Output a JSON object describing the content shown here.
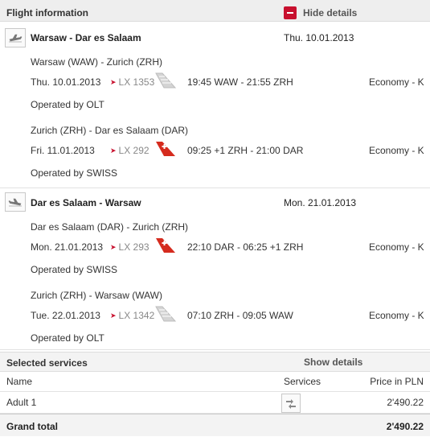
{
  "flight_information": {
    "title": "Flight information",
    "toggle_label": "Hide details",
    "journeys": [
      {
        "title": "Warsaw - Dar es Salaam",
        "date": "Thu. 10.01.2013",
        "segments": [
          {
            "route": "Warsaw (WAW) - Zurich (ZRH)",
            "date": "Thu. 10.01.2013",
            "flight": "LX 1353",
            "times": "19:45 WAW - 21:55 ZRH",
            "class": "Economy - K",
            "operated": "Operated by OLT",
            "tail": "grey"
          },
          {
            "route": "Zurich (ZRH) - Dar es Salaam (DAR)",
            "date": "Fri. 11.01.2013",
            "flight": "LX 292",
            "times": "09:25 +1 ZRH - 21:00 DAR",
            "class": "Economy - K",
            "operated": "Operated by SWISS",
            "tail": "swiss"
          }
        ]
      },
      {
        "title": "Dar es Salaam - Warsaw",
        "date": "Mon. 21.01.2013",
        "segments": [
          {
            "route": "Dar es Salaam (DAR) - Zurich (ZRH)",
            "date": "Mon. 21.01.2013",
            "flight": "LX 293",
            "times": "22:10 DAR - 06:25 +1 ZRH",
            "class": "Economy - K",
            "operated": "Operated by SWISS",
            "tail": "swiss"
          },
          {
            "route": "Zurich (ZRH) - Warsaw (WAW)",
            "date": "Tue. 22.01.2013",
            "flight": "LX 1342",
            "times": "07:10 ZRH - 09:05 WAW",
            "class": "Economy - K",
            "operated": "Operated by OLT",
            "tail": "grey"
          }
        ]
      }
    ]
  },
  "selected_services": {
    "title": "Selected services",
    "toggle_label": "Show details",
    "columns": {
      "name": "Name",
      "services": "Services",
      "price": "Price in PLN"
    },
    "rows": [
      {
        "name": "Adult 1",
        "price": "2'490.22"
      }
    ],
    "grand_total_label": "Grand total",
    "grand_total_value": "2'490.22"
  },
  "colors": {
    "accent": "#c8102e",
    "header_bg": "#eeeeee"
  }
}
